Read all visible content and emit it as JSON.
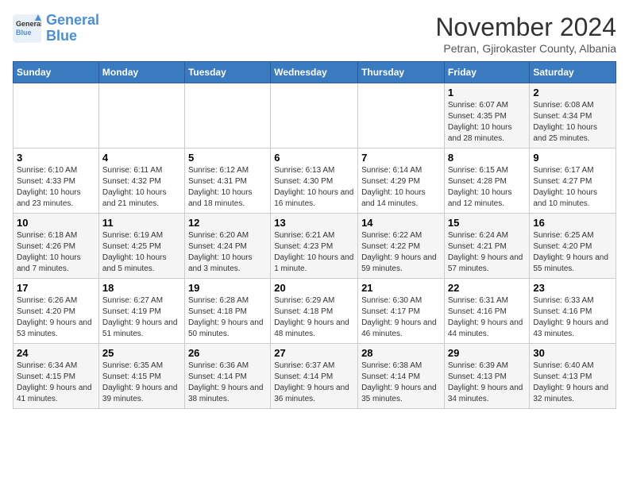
{
  "logo": {
    "line1": "General",
    "line2": "Blue"
  },
  "title": "November 2024",
  "subtitle": "Petran, Gjirokaster County, Albania",
  "days_of_week": [
    "Sunday",
    "Monday",
    "Tuesday",
    "Wednesday",
    "Thursday",
    "Friday",
    "Saturday"
  ],
  "weeks": [
    [
      {
        "day": "",
        "info": ""
      },
      {
        "day": "",
        "info": ""
      },
      {
        "day": "",
        "info": ""
      },
      {
        "day": "",
        "info": ""
      },
      {
        "day": "",
        "info": ""
      },
      {
        "day": "1",
        "info": "Sunrise: 6:07 AM\nSunset: 4:35 PM\nDaylight: 10 hours and 28 minutes."
      },
      {
        "day": "2",
        "info": "Sunrise: 6:08 AM\nSunset: 4:34 PM\nDaylight: 10 hours and 25 minutes."
      }
    ],
    [
      {
        "day": "3",
        "info": "Sunrise: 6:10 AM\nSunset: 4:33 PM\nDaylight: 10 hours and 23 minutes."
      },
      {
        "day": "4",
        "info": "Sunrise: 6:11 AM\nSunset: 4:32 PM\nDaylight: 10 hours and 21 minutes."
      },
      {
        "day": "5",
        "info": "Sunrise: 6:12 AM\nSunset: 4:31 PM\nDaylight: 10 hours and 18 minutes."
      },
      {
        "day": "6",
        "info": "Sunrise: 6:13 AM\nSunset: 4:30 PM\nDaylight: 10 hours and 16 minutes."
      },
      {
        "day": "7",
        "info": "Sunrise: 6:14 AM\nSunset: 4:29 PM\nDaylight: 10 hours and 14 minutes."
      },
      {
        "day": "8",
        "info": "Sunrise: 6:15 AM\nSunset: 4:28 PM\nDaylight: 10 hours and 12 minutes."
      },
      {
        "day": "9",
        "info": "Sunrise: 6:17 AM\nSunset: 4:27 PM\nDaylight: 10 hours and 10 minutes."
      }
    ],
    [
      {
        "day": "10",
        "info": "Sunrise: 6:18 AM\nSunset: 4:26 PM\nDaylight: 10 hours and 7 minutes."
      },
      {
        "day": "11",
        "info": "Sunrise: 6:19 AM\nSunset: 4:25 PM\nDaylight: 10 hours and 5 minutes."
      },
      {
        "day": "12",
        "info": "Sunrise: 6:20 AM\nSunset: 4:24 PM\nDaylight: 10 hours and 3 minutes."
      },
      {
        "day": "13",
        "info": "Sunrise: 6:21 AM\nSunset: 4:23 PM\nDaylight: 10 hours and 1 minute."
      },
      {
        "day": "14",
        "info": "Sunrise: 6:22 AM\nSunset: 4:22 PM\nDaylight: 9 hours and 59 minutes."
      },
      {
        "day": "15",
        "info": "Sunrise: 6:24 AM\nSunset: 4:21 PM\nDaylight: 9 hours and 57 minutes."
      },
      {
        "day": "16",
        "info": "Sunrise: 6:25 AM\nSunset: 4:20 PM\nDaylight: 9 hours and 55 minutes."
      }
    ],
    [
      {
        "day": "17",
        "info": "Sunrise: 6:26 AM\nSunset: 4:20 PM\nDaylight: 9 hours and 53 minutes."
      },
      {
        "day": "18",
        "info": "Sunrise: 6:27 AM\nSunset: 4:19 PM\nDaylight: 9 hours and 51 minutes."
      },
      {
        "day": "19",
        "info": "Sunrise: 6:28 AM\nSunset: 4:18 PM\nDaylight: 9 hours and 50 minutes."
      },
      {
        "day": "20",
        "info": "Sunrise: 6:29 AM\nSunset: 4:18 PM\nDaylight: 9 hours and 48 minutes."
      },
      {
        "day": "21",
        "info": "Sunrise: 6:30 AM\nSunset: 4:17 PM\nDaylight: 9 hours and 46 minutes."
      },
      {
        "day": "22",
        "info": "Sunrise: 6:31 AM\nSunset: 4:16 PM\nDaylight: 9 hours and 44 minutes."
      },
      {
        "day": "23",
        "info": "Sunrise: 6:33 AM\nSunset: 4:16 PM\nDaylight: 9 hours and 43 minutes."
      }
    ],
    [
      {
        "day": "24",
        "info": "Sunrise: 6:34 AM\nSunset: 4:15 PM\nDaylight: 9 hours and 41 minutes."
      },
      {
        "day": "25",
        "info": "Sunrise: 6:35 AM\nSunset: 4:15 PM\nDaylight: 9 hours and 39 minutes."
      },
      {
        "day": "26",
        "info": "Sunrise: 6:36 AM\nSunset: 4:14 PM\nDaylight: 9 hours and 38 minutes."
      },
      {
        "day": "27",
        "info": "Sunrise: 6:37 AM\nSunset: 4:14 PM\nDaylight: 9 hours and 36 minutes."
      },
      {
        "day": "28",
        "info": "Sunrise: 6:38 AM\nSunset: 4:14 PM\nDaylight: 9 hours and 35 minutes."
      },
      {
        "day": "29",
        "info": "Sunrise: 6:39 AM\nSunset: 4:13 PM\nDaylight: 9 hours and 34 minutes."
      },
      {
        "day": "30",
        "info": "Sunrise: 6:40 AM\nSunset: 4:13 PM\nDaylight: 9 hours and 32 minutes."
      }
    ]
  ]
}
